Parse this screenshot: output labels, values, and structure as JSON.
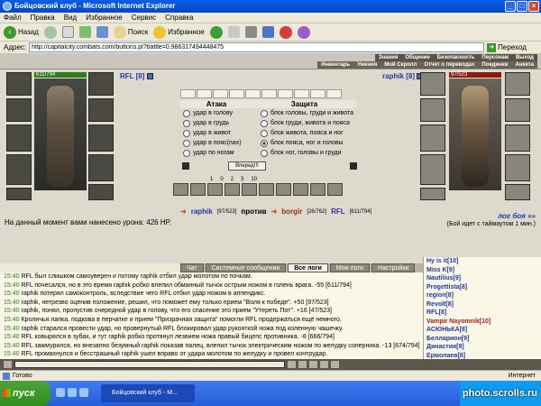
{
  "window": {
    "title": "Бойцовский клуб - Microsoft Internet Explorer"
  },
  "menu": [
    "Файл",
    "Правка",
    "Вид",
    "Избранное",
    "Сервис",
    "Справка"
  ],
  "toolbar": {
    "back": "Назад",
    "search": "Поиск",
    "favorites": "Избранное"
  },
  "address": {
    "label": "Адрес:",
    "url": "http://capitalcity.combats.com/buttons.pl?battle=0.986317494448475",
    "go": "Переход"
  },
  "game_nav": {
    "top": [
      "Знания",
      "Общение",
      "Безопасность",
      "Персонаж",
      "Выход"
    ],
    "bottom": [
      "Инвентарь",
      "Умения",
      "Мой Скролл",
      "Отчет о переводах",
      "Поединки",
      "Анкета"
    ]
  },
  "player_left": {
    "name": "RFL [8]",
    "hp": "611/794",
    "hp_frac": 0.77
  },
  "player_right": {
    "name": "raphik [8]",
    "hp": "97/523",
    "hp_frac": 0.19
  },
  "combat": {
    "attack_title": "Атака",
    "defense_title": "Защита",
    "attacks": [
      "удар в голову",
      "удар в грудь",
      "удар в живот",
      "удар в пояс(пах)",
      "удар по ногам"
    ],
    "defenses": [
      "блок головы, груди и живота",
      "блок груди, живота и пояса",
      "блок живота, пояса и ног",
      "блок пояса, ног и головы",
      "блок ног, головы и груди"
    ],
    "forward_button": "Вперед!!!"
  },
  "dice_nums": [
    "1",
    "0",
    "2",
    "3",
    "10"
  ],
  "damage_line": "На данный момент вами нанесено урона: 426 HP.",
  "versus": {
    "left": "raphik",
    "left_hp": "[97/523]",
    "word": "против",
    "middle": "borgir",
    "middle_hp": "[26/762]",
    "right": "RFL",
    "right_hp": "[611/794]"
  },
  "battle_log": "лог боя »»",
  "timeout": "(Бой идет с таймаутом 1 мин.)",
  "tabs": [
    "Чат",
    "Системные сообщения",
    "Все логи",
    "Мои логи",
    "Настройки"
  ],
  "active_tab": 2,
  "chat": [
    {
      "time": "15:40",
      "text": "RFL был слишком самоуверен и потому raphik отбил удар молотом по почкам."
    },
    {
      "time": "15:40",
      "text": "RFL почесался, но в это время raphik робко влепил обманный тычок острым ножом в голень врага. -55 [611/794]"
    },
    {
      "time": "15:40",
      "text": "raphik потерял самоконтроль, вследствие чего RFL отбил удар ножом в аппендикс."
    },
    {
      "time": "15:40",
      "text": "raphik, нетрезво оценив положение, решил, что поможет ему только прием \"Воля к победе\". +50 [97/523]"
    },
    {
      "time": "15:40",
      "text": "raphik, понял, пропустив очередной удар в голову, что его спасение это прием \"Утереть Пот\". +16 [47/523]"
    },
    {
      "time": "15:40",
      "text": "Кроличья лапка, подкова в перчатке и прием \"Призрачная защита\" помогли RFL продержаться ещё немного."
    },
    {
      "time": "15:40",
      "text": "raphik старался провести удар, но провернутый RFL блокировал удар рукояткой ножа под коленную чашечку."
    },
    {
      "time": "15:40",
      "text": "RFL ковырялся в зубах, и тут raphik робко протянул лезвием ножа правый бицепс противника. -8 [666/794]"
    },
    {
      "time": "15:40",
      "text": "RFL зажмурился, но внезапно безумный raphik показав палец, влепил тычок электрическим ножом по желудку соперника. -13 [674/794]"
    },
    {
      "time": "15:40",
      "text": "RFL промахнулся и бесстрашный raphik ушел вправо от удара молотом по желудку и провел контрудар."
    }
  ],
  "users": [
    "Hy is it[10]",
    "Miss K[9]",
    "Nautilius[9]",
    "Progettista[8]",
    "region[8]",
    "Revolt[8]",
    "RFL[8]",
    "Vampir Nayomnik[10]",
    "АСЮНЬКА[8]",
    "Белларион[9]",
    "Династия[9]",
    "Ермолаев[8]"
  ],
  "statusbar": {
    "left": "Готово",
    "right": "Интернет"
  },
  "taskbar": {
    "start": "пуск",
    "item": "Бойцовский клуб - M..."
  },
  "watermark": "photo.scrolls.ru"
}
